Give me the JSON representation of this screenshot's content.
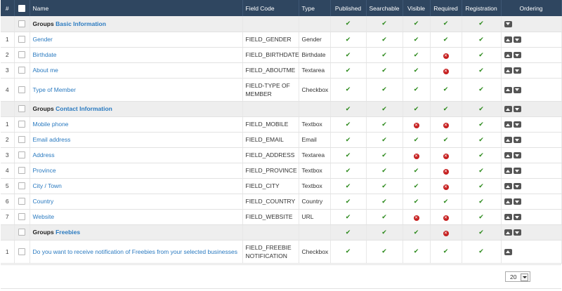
{
  "headers": {
    "num": "#",
    "name": "Name",
    "code": "Field Code",
    "type": "Type",
    "published": "Published",
    "searchable": "Searchable",
    "visible": "Visible",
    "required": "Required",
    "registration": "Registration",
    "ordering": "Ordering"
  },
  "group_prefix": "Groups",
  "colors": {
    "header_bg": "#2f4660",
    "link": "#2a7ac0",
    "tick": "#2e8b1e",
    "cross": "#c62020",
    "group_bg": "#eeeeee"
  },
  "icons": {
    "yes": "check-icon",
    "no": "cross-circle-icon",
    "up": "arrow-up-icon",
    "down": "arrow-down-icon"
  },
  "rows": [
    {
      "kind": "group",
      "name": "Basic Information",
      "published": true,
      "searchable": true,
      "visible": true,
      "required": true,
      "registration": true,
      "ordering": [
        "down"
      ]
    },
    {
      "kind": "field",
      "num": "1",
      "name": "Gender",
      "code": "FIELD_GENDER",
      "type": "Gender",
      "published": true,
      "searchable": true,
      "visible": true,
      "required": true,
      "registration": true,
      "ordering": [
        "up",
        "down"
      ]
    },
    {
      "kind": "field",
      "num": "2",
      "name": "Birthdate",
      "code": "FIELD_BIRTHDATE",
      "type": "Birthdate",
      "published": true,
      "searchable": true,
      "visible": true,
      "required": false,
      "registration": true,
      "ordering": [
        "up",
        "down"
      ]
    },
    {
      "kind": "field",
      "num": "3",
      "name": "About me",
      "code": "FIELD_ABOUTME",
      "type": "Textarea",
      "published": true,
      "searchable": true,
      "visible": true,
      "required": false,
      "registration": true,
      "ordering": [
        "up",
        "down"
      ]
    },
    {
      "kind": "field",
      "num": "4",
      "name": "Type of Member",
      "code": "FIELD-TYPE OF MEMBER",
      "type": "Checkbox",
      "published": true,
      "searchable": true,
      "visible": true,
      "required": true,
      "registration": true,
      "ordering": [
        "up",
        "down"
      ],
      "double": true
    },
    {
      "kind": "group",
      "name": "Contact Information",
      "published": true,
      "searchable": true,
      "visible": true,
      "required": true,
      "registration": true,
      "ordering": [
        "up",
        "down"
      ]
    },
    {
      "kind": "field",
      "num": "1",
      "name": "Mobile phone",
      "code": "FIELD_MOBILE",
      "type": "Textbox",
      "published": true,
      "searchable": true,
      "visible": false,
      "required": false,
      "registration": true,
      "ordering": [
        "up",
        "down"
      ]
    },
    {
      "kind": "field",
      "num": "2",
      "name": "Email address",
      "code": "FIELD_EMAIL",
      "type": "Email",
      "published": true,
      "searchable": true,
      "visible": true,
      "required": true,
      "registration": true,
      "ordering": [
        "up",
        "down"
      ]
    },
    {
      "kind": "field",
      "num": "3",
      "name": "Address",
      "code": "FIELD_ADDRESS",
      "type": "Textarea",
      "published": true,
      "searchable": true,
      "visible": false,
      "required": false,
      "registration": true,
      "ordering": [
        "up",
        "down"
      ]
    },
    {
      "kind": "field",
      "num": "4",
      "name": "Province",
      "code": "FIELD_PROVINCE",
      "type": "Textbox",
      "published": true,
      "searchable": true,
      "visible": true,
      "required": false,
      "registration": true,
      "ordering": [
        "up",
        "down"
      ]
    },
    {
      "kind": "field",
      "num": "5",
      "name": "City / Town",
      "code": "FIELD_CITY",
      "type": "Textbox",
      "published": true,
      "searchable": true,
      "visible": true,
      "required": false,
      "registration": true,
      "ordering": [
        "up",
        "down"
      ]
    },
    {
      "kind": "field",
      "num": "6",
      "name": "Country",
      "code": "FIELD_COUNTRY",
      "type": "Country",
      "published": true,
      "searchable": true,
      "visible": true,
      "required": true,
      "registration": true,
      "ordering": [
        "up",
        "down"
      ]
    },
    {
      "kind": "field",
      "num": "7",
      "name": "Website",
      "code": "FIELD_WEBSITE",
      "type": "URL",
      "published": true,
      "searchable": true,
      "visible": false,
      "required": false,
      "registration": true,
      "ordering": [
        "up",
        "down"
      ]
    },
    {
      "kind": "group",
      "name": "Freebies",
      "published": true,
      "searchable": true,
      "visible": true,
      "required": false,
      "registration": true,
      "ordering": [
        "up",
        "down"
      ]
    },
    {
      "kind": "field",
      "num": "1",
      "name": "Do you want to receive notification of Freebies from your selected businesses",
      "code": "FIELD_FREEBIE NOTIFICATION",
      "type": "Checkbox",
      "published": true,
      "searchable": true,
      "visible": true,
      "required": true,
      "registration": true,
      "ordering": [
        "up"
      ],
      "double": true
    }
  ],
  "pagination": {
    "limit": "20"
  }
}
